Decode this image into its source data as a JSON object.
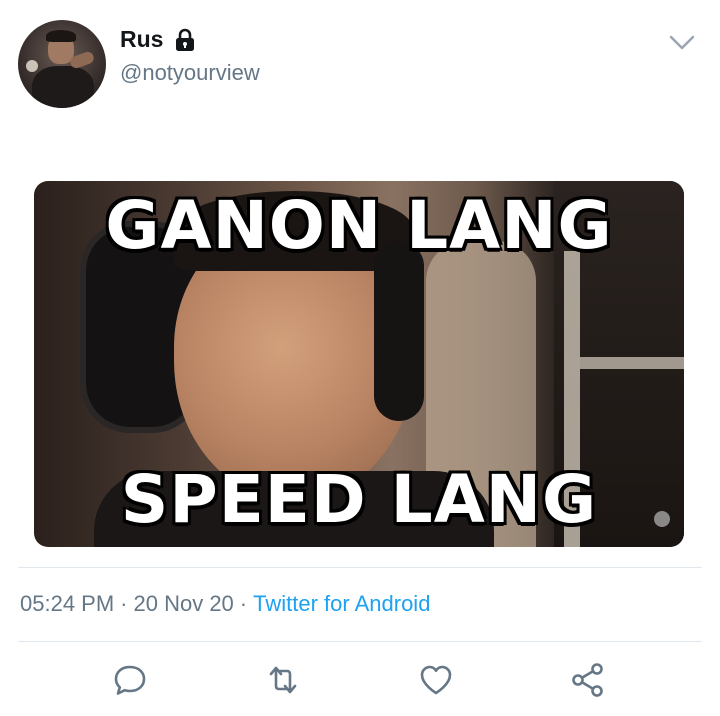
{
  "header": {
    "display_name": "Rus",
    "username": "@notyourview",
    "protected_icon": "lock-icon",
    "menu_icon": "chevron-down-icon"
  },
  "media": {
    "top_caption": "GANON LANG",
    "bottom_caption": "SPEED LANG"
  },
  "meta": {
    "time": "05:24 PM",
    "date": "20 Nov 20",
    "separator": "·",
    "client": "Twitter for Android"
  },
  "actions": [
    {
      "icon": "reply-icon"
    },
    {
      "icon": "retweet-icon"
    },
    {
      "icon": "like-icon"
    },
    {
      "icon": "share-icon"
    }
  ],
  "colors": {
    "text_primary": "#14171a",
    "text_secondary": "#657786",
    "link": "#1da1f2",
    "divider": "#e1e8ed"
  }
}
